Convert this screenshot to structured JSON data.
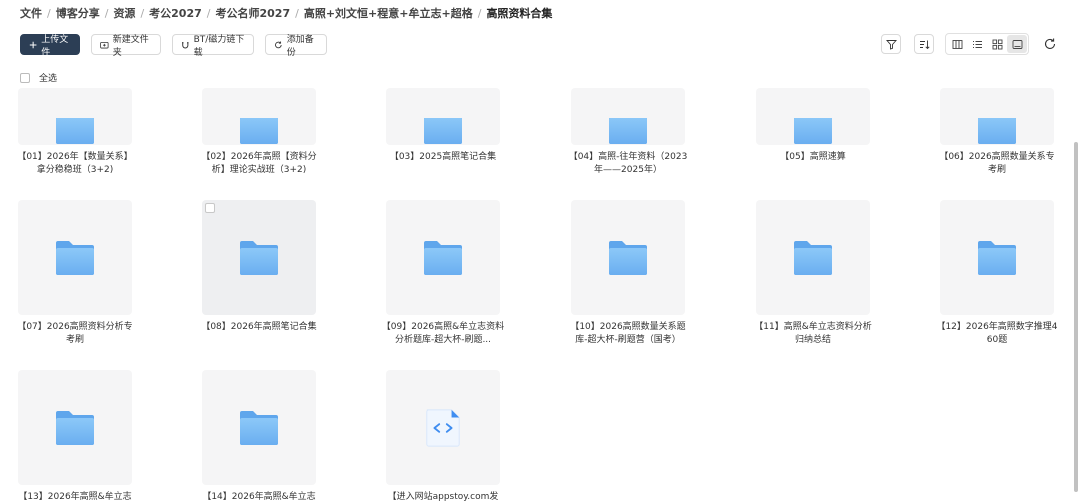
{
  "breadcrumb": [
    "文件",
    "博客分享",
    "资源",
    "考公2027",
    "考公名师2027",
    "高照+刘文恒+程意+牟立志+超格",
    "高照资料合集"
  ],
  "toolbar": {
    "upload_label": "上传文件",
    "new_folder_label": "新建文件夹",
    "bt_label": "BT/磁力链下载",
    "backup_label": "添加备份"
  },
  "select_all_label": "全选",
  "icons": {
    "upload": "plus-icon",
    "new_folder": "folder-plus-icon",
    "bt": "magnet-icon",
    "backup": "sync-icon",
    "filter": "filter-icon",
    "sort": "sort-icon",
    "views": [
      "column-view-icon",
      "list-view-icon",
      "grid-view-icon",
      "thumbnail-view-icon"
    ],
    "refresh": "refresh-icon"
  },
  "colors": {
    "primary_button": "#2c3e55",
    "folder": "#6fb4f2",
    "thumb_bg": "#f5f5f6"
  },
  "items": [
    {
      "name": "【01】2026年【数量关系】拿分稳稳班（3+2)",
      "type": "folder"
    },
    {
      "name": "【02】2026年高照【资料分析】理论实战班（3+2)",
      "type": "folder"
    },
    {
      "name": "【03】2025高照笔记合集",
      "type": "folder"
    },
    {
      "name": "【04】高照-往年资料（2023年——2025年）",
      "type": "folder"
    },
    {
      "name": "【05】高照速算",
      "type": "folder"
    },
    {
      "name": "【06】2026高照数量关系专考刷",
      "type": "folder"
    },
    {
      "name": "【07】2026高照资料分析专考刷",
      "type": "folder"
    },
    {
      "name": "【08】2026年高照笔记合集",
      "type": "folder"
    },
    {
      "name": "【09】2026高照&牟立志资料分析题库-超大杯-刷题...",
      "type": "folder"
    },
    {
      "name": "【10】2026高照数量关系题库-超大杯-刷题营（国考）",
      "type": "folder"
    },
    {
      "name": "【11】高照&牟立志资料分析归纳总结",
      "type": "folder"
    },
    {
      "name": "【12】2026年高照数字推理460题",
      "type": "folder"
    },
    {
      "name": "【13】2026年高照&牟立志",
      "type": "folder"
    },
    {
      "name": "【14】2026年高照&牟立志",
      "type": "folder"
    },
    {
      "name": "【进入网站appstoy.com发",
      "type": "code-file"
    }
  ]
}
